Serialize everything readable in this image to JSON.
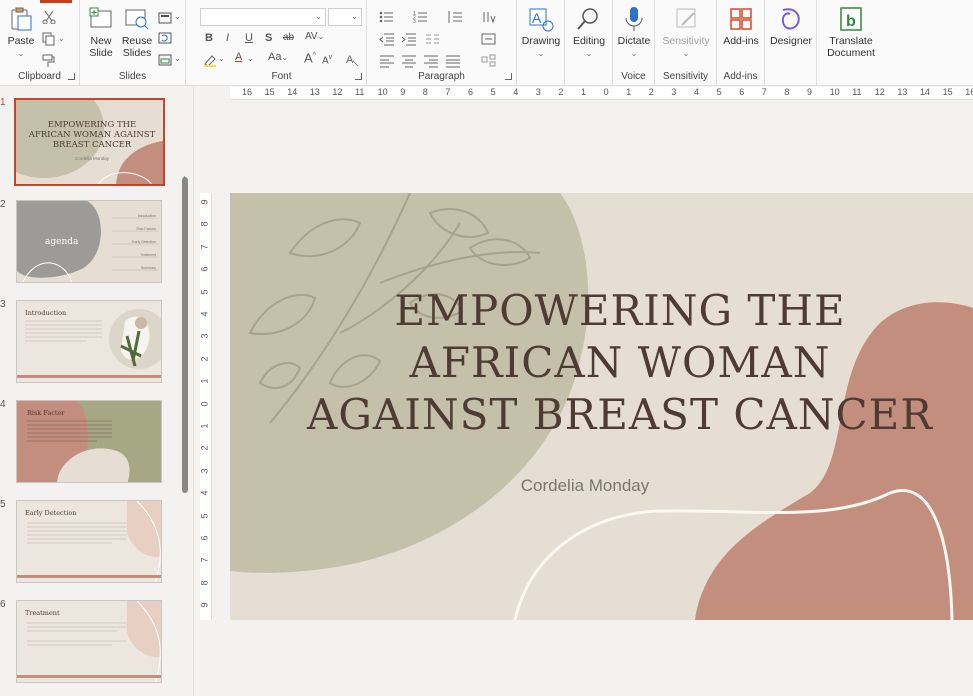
{
  "ribbon": {
    "clipboard": {
      "label": "Clipboard",
      "paste": "Paste"
    },
    "slides": {
      "label": "Slides",
      "new_slide": "New Slide",
      "reuse_slides": "Reuse Slides"
    },
    "font": {
      "label": "Font",
      "bold": "B",
      "italic": "I",
      "underline": "U",
      "shadow": "S",
      "strike": "ab",
      "spacing": "AV",
      "color_a": "A",
      "case": "Aa",
      "grow": "A",
      "shrink": "A"
    },
    "paragraph": {
      "label": "Paragraph"
    },
    "drawing": {
      "label": "Drawing"
    },
    "editing": {
      "label": "Editing"
    },
    "voice": {
      "label": "Voice",
      "dictate": "Dictate"
    },
    "sensitivity": {
      "label": "Sensitivity",
      "button": "Sensitivity"
    },
    "addins": {
      "label": "Add-ins",
      "button": "Add-ins"
    },
    "designer": {
      "button": "Designer"
    },
    "translate": {
      "button": "Translate Document"
    }
  },
  "ruler": {
    "horizontal": [
      "16",
      "15",
      "14",
      "13",
      "12",
      "11",
      "10",
      "9",
      "8",
      "7",
      "6",
      "5",
      "4",
      "3",
      "2",
      "1",
      "0",
      "1",
      "2",
      "3",
      "4",
      "5",
      "6",
      "7",
      "8",
      "9",
      "10",
      "11",
      "12",
      "13",
      "14",
      "15",
      "16"
    ],
    "vertical": [
      "9",
      "8",
      "7",
      "6",
      "5",
      "4",
      "3",
      "2",
      "1",
      "0",
      "1",
      "2",
      "3",
      "4",
      "5",
      "6",
      "7",
      "8",
      "9"
    ]
  },
  "thumbnails": [
    {
      "num": "1",
      "title": "EMPOWERING THE AFRICAN WOMAN AGAINST BREAST CANCER",
      "sub": "Cordelia Monday"
    },
    {
      "num": "2",
      "title": "agenda",
      "items": [
        "Introduction",
        "Risk Factors",
        "Early Detection",
        "Treatment",
        "Summary"
      ]
    },
    {
      "num": "3",
      "title": "Introduction"
    },
    {
      "num": "4",
      "title": "Risk Factor"
    },
    {
      "num": "5",
      "title": "Early Detection"
    },
    {
      "num": "6",
      "title": "Treatment"
    }
  ],
  "slide": {
    "title_line1": "EMPOWERING THE",
    "title_line2": "AFRICAN WOMAN",
    "title_line3": "AGAINST BREAST CANCER",
    "subtitle": "Cordelia Monday"
  },
  "colors": {
    "accent_red": "#c43e1c",
    "slide_bg": "#e6ddd3",
    "olive": "#c5c0aa",
    "terracotta": "#c48e7f",
    "title_text": "#4e3b33"
  }
}
